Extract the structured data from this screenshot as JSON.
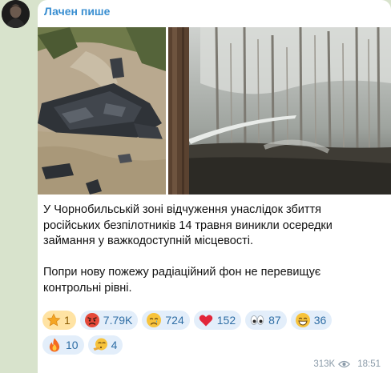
{
  "channel": {
    "name": "Лачен пише"
  },
  "post": {
    "paragraphs": [
      "У Чорнобильській зоні відчуження унаслідок збиття російських безпілотників 14 травня виникли осередки займання у важкодоступній місцевості.",
      "Попри нову пожежу радіаційний фон не перевищує контрольні рівні."
    ]
  },
  "photos": [
    {
      "icon": "drone-wreckage-photo"
    },
    {
      "icon": "forest-fire-photo"
    }
  ],
  "reactions": [
    {
      "icon": "star-icon",
      "count": "1"
    },
    {
      "icon": "angry-face-icon",
      "count": "7.79K"
    },
    {
      "icon": "crying-face-icon",
      "count": "724"
    },
    {
      "icon": "heart-icon",
      "count": "152"
    },
    {
      "icon": "eyes-icon",
      "count": "87"
    },
    {
      "icon": "grinning-face-icon",
      "count": "36"
    },
    {
      "icon": "fire-icon",
      "count": "10"
    },
    {
      "icon": "shushing-face-icon",
      "count": "4"
    }
  ],
  "meta": {
    "views": "313K",
    "time": "18:51"
  },
  "colors": {
    "channel_name": "#3a8fd1",
    "chat_background": "#d8e3cc",
    "reaction_chip": "#e3eefa",
    "paid_reaction_chip": "#ffe3a3"
  }
}
